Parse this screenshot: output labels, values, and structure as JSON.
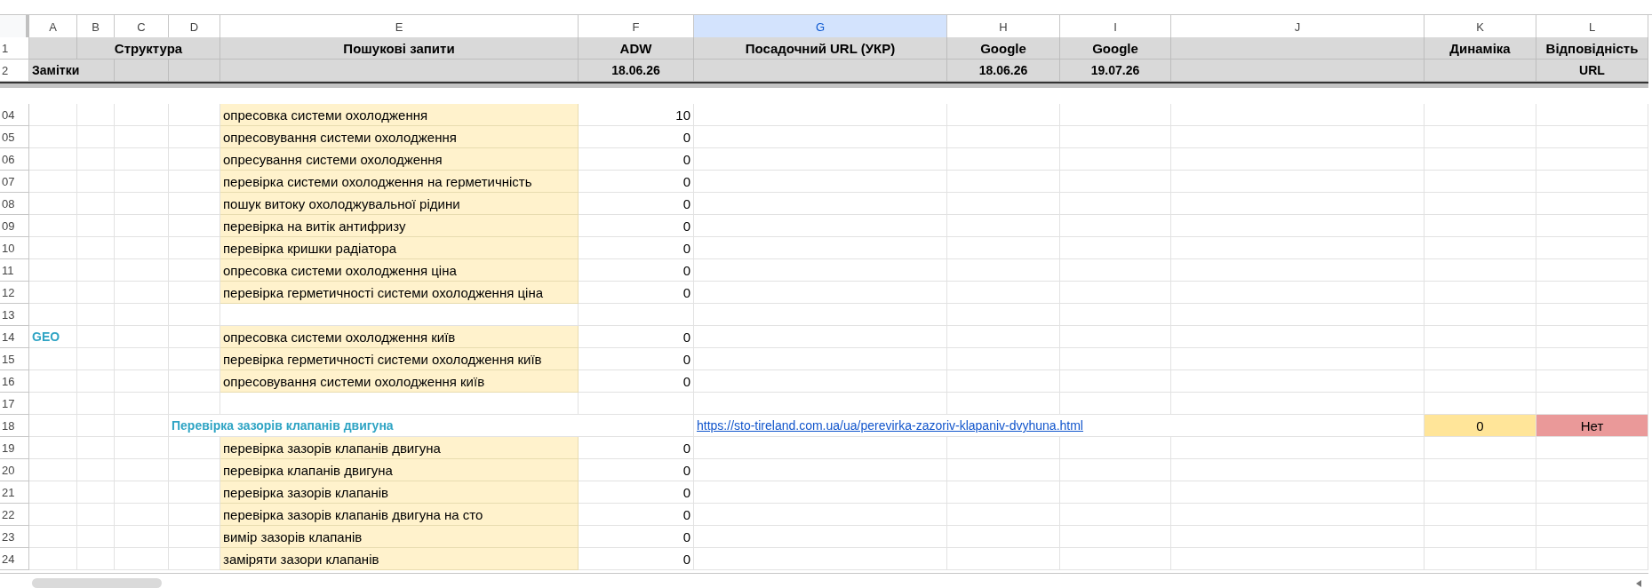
{
  "columns": [
    {
      "label": "A",
      "selected": false
    },
    {
      "label": "B",
      "selected": false
    },
    {
      "label": "C",
      "selected": false
    },
    {
      "label": "D",
      "selected": false
    },
    {
      "label": "E",
      "selected": false
    },
    {
      "label": "F",
      "selected": false
    },
    {
      "label": "G",
      "selected": true
    },
    {
      "label": "H",
      "selected": false
    },
    {
      "label": "I",
      "selected": false
    },
    {
      "label": "J",
      "selected": false
    },
    {
      "label": "K",
      "selected": false
    },
    {
      "label": "L",
      "selected": false
    }
  ],
  "header_rows": [
    {
      "number": "1",
      "structure": "Структура",
      "queries": "Пошукові запити",
      "adw": "ADW",
      "url": "Посадочний URL (УКР)",
      "google_1": "Google",
      "google_2": "Google",
      "dynamics": "Динаміка",
      "match": "Відповідність"
    },
    {
      "number": "2",
      "notes": "Замітки",
      "adw": "18.06.26",
      "google_1": "18.06.26",
      "google_2": "19.07.26",
      "match": "URL"
    }
  ],
  "rows": [
    {
      "number": "04",
      "query": "опресовка системи охолодження",
      "adw": "10"
    },
    {
      "number": "05",
      "query": "опресовування системи охолодження",
      "adw": "0"
    },
    {
      "number": "06",
      "query": "опресування системи охолодження",
      "adw": "0"
    },
    {
      "number": "07",
      "query": "перевірка системи охолодження на герметичність",
      "adw": "0"
    },
    {
      "number": "08",
      "query": "пошук витоку охолоджувальної рідини",
      "adw": "0"
    },
    {
      "number": "09",
      "query": "перевірка на витік антифризу",
      "adw": "0"
    },
    {
      "number": "10",
      "query": "перевірка кришки радіатора",
      "adw": "0"
    },
    {
      "number": "11",
      "query": "опресовка системи охолодження ціна",
      "adw": "0"
    },
    {
      "number": "12",
      "query": "перевірка герметичності системи охолодження ціна",
      "adw": "0"
    },
    {
      "number": "13"
    },
    {
      "number": "14",
      "note": "GEO",
      "query": "опресовка системи охолодження київ",
      "adw": "0"
    },
    {
      "number": "15",
      "query": "перевірка герметичності системи охолодження київ",
      "adw": "0"
    },
    {
      "number": "16",
      "query": "опресовування системи охолодження київ",
      "adw": "0"
    },
    {
      "number": "17"
    },
    {
      "number": "18",
      "section": "Перевірка зазорів клапанів двигуна",
      "url": "https://sto-tireland.com.ua/ua/perevirka-zazoriv-klapaniv-dvyhuna.html",
      "dynamics": {
        "text": "0",
        "color": "#ffe599"
      },
      "match": {
        "text": "Нет",
        "color": "#ea9999"
      }
    },
    {
      "number": "19",
      "query": "перевірка зазорів клапанів двигуна",
      "adw": "0"
    },
    {
      "number": "20",
      "query": "перевірка клапанів двигуна",
      "adw": "0"
    },
    {
      "number": "21",
      "query": "перевірка зазорів клапанів",
      "adw": "0"
    },
    {
      "number": "22",
      "query": "перевірка зазорів клапанів двигуна на сто",
      "adw": "0"
    },
    {
      "number": "23",
      "query": "вимір зазорів клапанів",
      "adw": "0"
    },
    {
      "number": "24",
      "query": "заміряти зазори клапанів",
      "adw": "0"
    }
  ]
}
